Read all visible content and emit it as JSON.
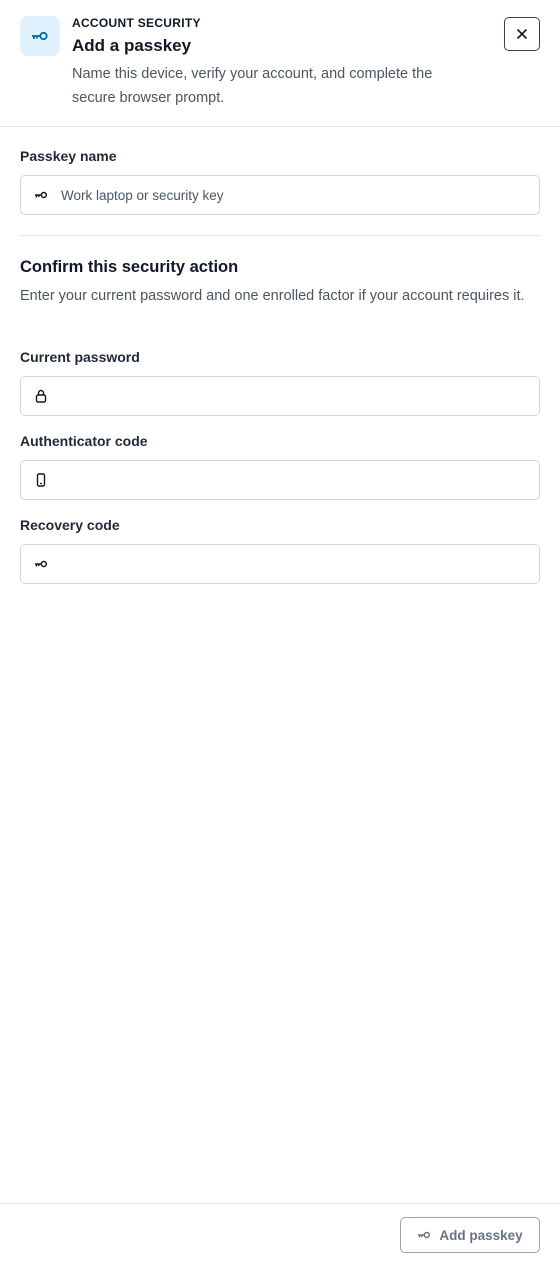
{
  "header": {
    "eyebrow": "ACCOUNT SECURITY",
    "title": "Add a passkey",
    "subtitle": "Name this device, verify your account, and complete the secure browser prompt.",
    "icon": "key-icon",
    "close_icon": "close-icon"
  },
  "passkey_name": {
    "label": "Passkey name",
    "placeholder": "Work laptop or security key",
    "value": "",
    "icon": "key-icon"
  },
  "verification": {
    "title": "Confirm this security action",
    "description": "Enter your current password and one enrolled factor if your account requires it.",
    "current_password": {
      "label": "Current password",
      "value": "",
      "icon": "lock-icon"
    },
    "authenticator_code": {
      "label": "Authenticator code",
      "value": "",
      "icon": "phone-icon"
    },
    "recovery_code": {
      "label": "Recovery code",
      "value": "",
      "icon": "key-icon"
    }
  },
  "footer": {
    "submit_label": "Add passkey",
    "submit_icon": "key-icon",
    "submit_disabled": true
  },
  "colors": {
    "accent": "#0369a1",
    "icon_tile_bg": "#e0f2fe",
    "border": "#d1d5db",
    "muted_text": "#4b5563"
  }
}
